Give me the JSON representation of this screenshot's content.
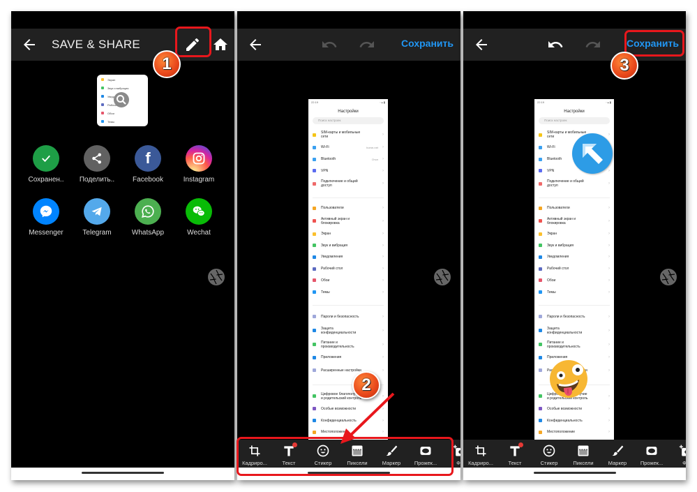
{
  "panel1": {
    "title": "SAVE & SHARE",
    "share_targets": [
      {
        "label": "Сохранен..",
        "icon": "check-icon",
        "color": "#1e9e46"
      },
      {
        "label": "Поделить..",
        "icon": "share-icon",
        "color": "#616161"
      },
      {
        "label": "Facebook",
        "icon": "facebook-icon",
        "color": "#3b5998"
      },
      {
        "label": "Instagram",
        "icon": "instagram-icon",
        "color": "#d6249f"
      },
      {
        "label": "Messenger",
        "icon": "messenger-icon",
        "color": "#0084ff"
      },
      {
        "label": "Telegram",
        "icon": "telegram-icon",
        "color": "#54a9eb"
      },
      {
        "label": "WhatsApp",
        "icon": "whatsapp-icon",
        "color": "#4caf50"
      },
      {
        "label": "Wechat",
        "icon": "wechat-icon",
        "color": "#09bb07"
      }
    ],
    "thumbnail_rows": [
      "Экран",
      "Звук и вибрация",
      "Уведомления",
      "Рабочий стол",
      "Обои",
      "Темы"
    ]
  },
  "editor": {
    "save_label": "Сохранить",
    "tools": [
      {
        "label": "Кадриро...",
        "icon": "crop-icon"
      },
      {
        "label": "Текст",
        "icon": "text-icon"
      },
      {
        "label": "Стикер",
        "icon": "sticker-icon"
      },
      {
        "label": "Пиксели",
        "icon": "pixelate-icon"
      },
      {
        "label": "Маркер",
        "icon": "brush-icon"
      },
      {
        "label": "Прожек...",
        "icon": "spotlight-icon"
      },
      {
        "label": "Фо",
        "icon": "add-photo-icon"
      }
    ]
  },
  "screenshot": {
    "time": "22:19",
    "title": "Настройки",
    "search_placeholder": "Поиск настроек",
    "groups": [
      [
        {
          "label": "SIM-карты и мобильные сети",
          "color": "#f5c518"
        },
        {
          "label": "Wi-Fi",
          "color": "#3aa0f0",
          "value": "home-net"
        },
        {
          "label": "Bluetooth",
          "color": "#3aa0f0",
          "value": "Откл"
        },
        {
          "label": "VPN",
          "color": "#5b6bf0"
        },
        {
          "label": "Подключение и общий доступ",
          "color": "#ef6a6a"
        }
      ],
      [
        {
          "label": "Пользователи",
          "color": "#f5a623"
        },
        {
          "label": "Активный экран и блокировка",
          "color": "#ef5350"
        },
        {
          "label": "Экран",
          "color": "#fbc02d"
        },
        {
          "label": "Звук и вибрация",
          "color": "#43c463"
        },
        {
          "label": "Уведомления",
          "color": "#1e88e5"
        },
        {
          "label": "Рабочий стол",
          "color": "#5c6bc0"
        },
        {
          "label": "Обои",
          "color": "#e5566b"
        },
        {
          "label": "Темы",
          "color": "#2196f3"
        }
      ],
      [
        {
          "label": "Пароли и безопасность",
          "color": "#9fa8da"
        },
        {
          "label": "Защита конфиденциальности",
          "color": "#1e88e5"
        },
        {
          "label": "Питание и производительность",
          "color": "#43c463"
        },
        {
          "label": "Приложения",
          "color": "#1e88e5"
        },
        {
          "label": "Расширенные настройки",
          "color": "#9fa8da"
        }
      ],
      [
        {
          "label": "Цифровое благополучие и родительский контроль",
          "color": "#43c463"
        },
        {
          "label": "Особые возможности",
          "color": "#7e57c2"
        },
        {
          "label": "Конфиденциальность",
          "color": "#1e88e5"
        },
        {
          "label": "Местоположение",
          "color": "#f5a623"
        }
      ]
    ]
  },
  "annotations": {
    "steps": [
      "1",
      "2",
      "3"
    ],
    "highlight_color": "#e8171c"
  }
}
